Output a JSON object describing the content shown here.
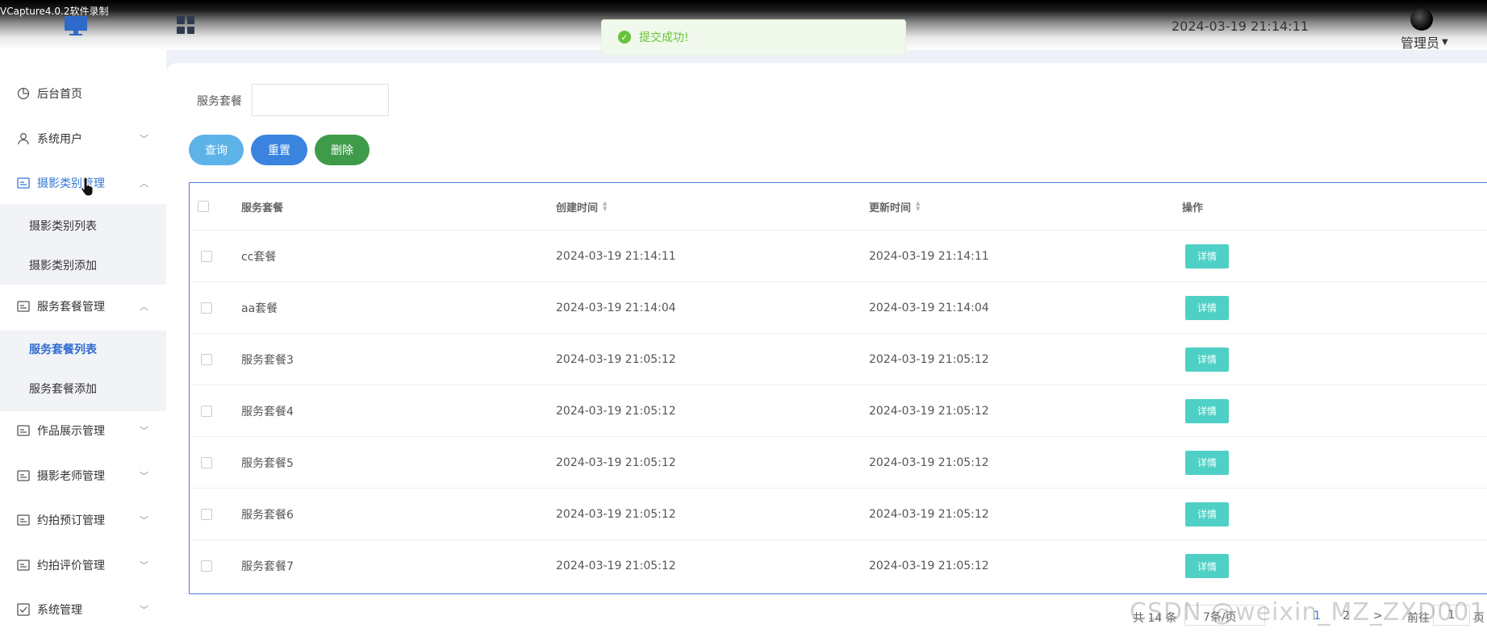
{
  "capture_label": "VCapture4.0.2软件录制",
  "header": {
    "datetime": "2024-03-19 21:14:11",
    "user": "管理员"
  },
  "toast": {
    "text": "提交成功!"
  },
  "sidebar": {
    "items": [
      {
        "label": "后台首页",
        "icon": "clock-icon"
      },
      {
        "label": "系统用户",
        "icon": "user-icon"
      },
      {
        "label": "摄影类别管理",
        "icon": "card-icon",
        "expanded": true,
        "children": [
          "摄影类别列表",
          "摄影类别添加"
        ]
      },
      {
        "label": "服务套餐管理",
        "icon": "card-icon",
        "expanded": true,
        "children": [
          "服务套餐列表",
          "服务套餐添加"
        ],
        "active_child": "服务套餐列表"
      },
      {
        "label": "作品展示管理",
        "icon": "card-icon"
      },
      {
        "label": "摄影老师管理",
        "icon": "card-icon"
      },
      {
        "label": "约拍预订管理",
        "icon": "card-icon"
      },
      {
        "label": "约拍评价管理",
        "icon": "card-icon"
      },
      {
        "label": "系统管理",
        "icon": "check-box-icon"
      }
    ]
  },
  "search": {
    "label": "服务套餐",
    "value": ""
  },
  "buttons": {
    "query": "查询",
    "reset": "重置",
    "delete": "删除"
  },
  "table": {
    "headers": [
      "服务套餐",
      "创建时间",
      "更新时间",
      "操作"
    ],
    "rows": [
      {
        "name": "cc套餐",
        "created": "2024-03-19 21:14:11",
        "updated": "2024-03-19 21:14:11",
        "action": "详情"
      },
      {
        "name": "aa套餐",
        "created": "2024-03-19 21:14:04",
        "updated": "2024-03-19 21:14:04",
        "action": "详情"
      },
      {
        "name": "服务套餐3",
        "created": "2024-03-19 21:05:12",
        "updated": "2024-03-19 21:05:12",
        "action": "详情"
      },
      {
        "name": "服务套餐4",
        "created": "2024-03-19 21:05:12",
        "updated": "2024-03-19 21:05:12",
        "action": "详情"
      },
      {
        "name": "服务套餐5",
        "created": "2024-03-19 21:05:12",
        "updated": "2024-03-19 21:05:12",
        "action": "详情"
      },
      {
        "name": "服务套餐6",
        "created": "2024-03-19 21:05:12",
        "updated": "2024-03-19 21:05:12",
        "action": "详情"
      },
      {
        "name": "服务套餐7",
        "created": "2024-03-19 21:05:12",
        "updated": "2024-03-19 21:05:12",
        "action": "详情"
      }
    ]
  },
  "pagination": {
    "total": "共 14 条",
    "page_size": "7条/页",
    "pages": [
      "1",
      "2"
    ],
    "current": "1",
    "next": ">",
    "goto": "前往",
    "goto_value": "1",
    "goto_suffix": "页"
  },
  "watermark": "CSDN @weixin_MZ_ZXD001",
  "colors": {
    "accent": "#3478d4",
    "success": "#67c23a",
    "detail": "#4fd0c6",
    "query": "#5db2e8",
    "reset": "#3a84e0",
    "delete": "#3e9b4a"
  }
}
